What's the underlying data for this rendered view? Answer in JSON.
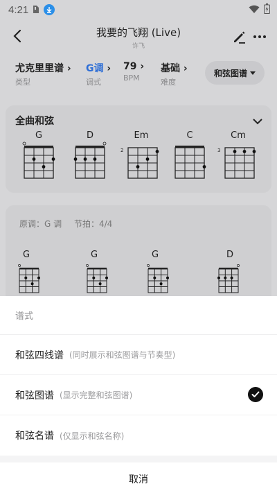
{
  "status_bar": {
    "time": "4:21"
  },
  "header": {
    "song_title": "我要的飞翔 (Live)",
    "artist": "许飞"
  },
  "properties": [
    {
      "value": "尤克里里谱",
      "label": "类型",
      "highlight": false
    },
    {
      "value": "G调",
      "label": "调式",
      "highlight": true
    },
    {
      "value": "79",
      "label": "BPM",
      "highlight": false
    },
    {
      "value": "基础",
      "label": "难度",
      "highlight": false
    }
  ],
  "sheet_type_button": "和弦图谱",
  "all_chords": {
    "title": "全曲和弦",
    "chords": [
      "G",
      "D",
      "Em",
      "C",
      "Cm"
    ]
  },
  "score": {
    "original_key": "原调：G 调",
    "beat": "节拍：4/4",
    "chords": [
      "G",
      "G",
      "G",
      "D"
    ]
  },
  "bottom_sheet": {
    "title": "谱式",
    "options": [
      {
        "label": "和弦四线谱",
        "desc": "(同时展示和弦图谱与节奏型)",
        "selected": false
      },
      {
        "label": "和弦图谱",
        "desc": "(显示完整和弦图谱)",
        "selected": true
      },
      {
        "label": "和弦名谱",
        "desc": "(仅显示和弦名称)",
        "selected": false
      }
    ],
    "cancel": "取消"
  },
  "colors": {
    "accent_blue": "#2f6fd6",
    "download_badge": "#2b8fe8",
    "check_bg": "#111111"
  }
}
